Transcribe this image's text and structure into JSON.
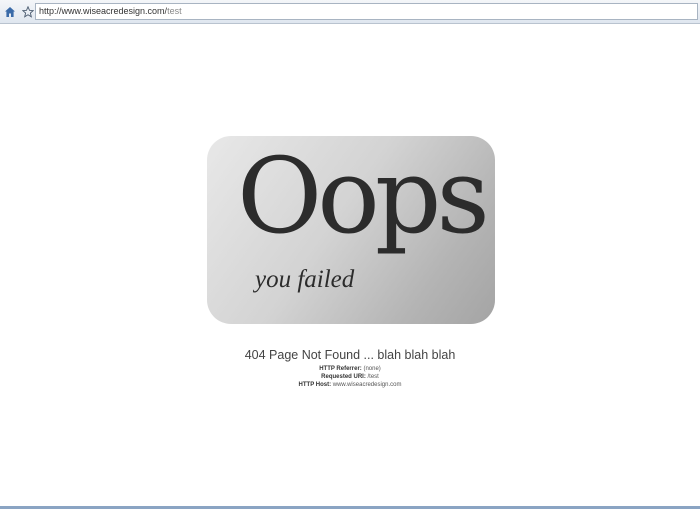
{
  "browser": {
    "url_host": "http://www.wiseacredesign.com/",
    "url_path": "test",
    "icons": [
      "home-icon",
      "star-icon"
    ]
  },
  "card": {
    "headline": "Oops",
    "subline": "you failed"
  },
  "info": {
    "title": "404 Page Not Found ... blah blah blah",
    "referrer_label": "HTTP Referrer:",
    "referrer_value": "(none)",
    "uri_label": "Requested URI:",
    "uri_value": "/test",
    "host_label": "HTTP Host:",
    "host_value": "www.wiseacredesign.com"
  },
  "colors": {
    "accent": "#8aa4c3",
    "text_dark": "#2c2c2c"
  }
}
